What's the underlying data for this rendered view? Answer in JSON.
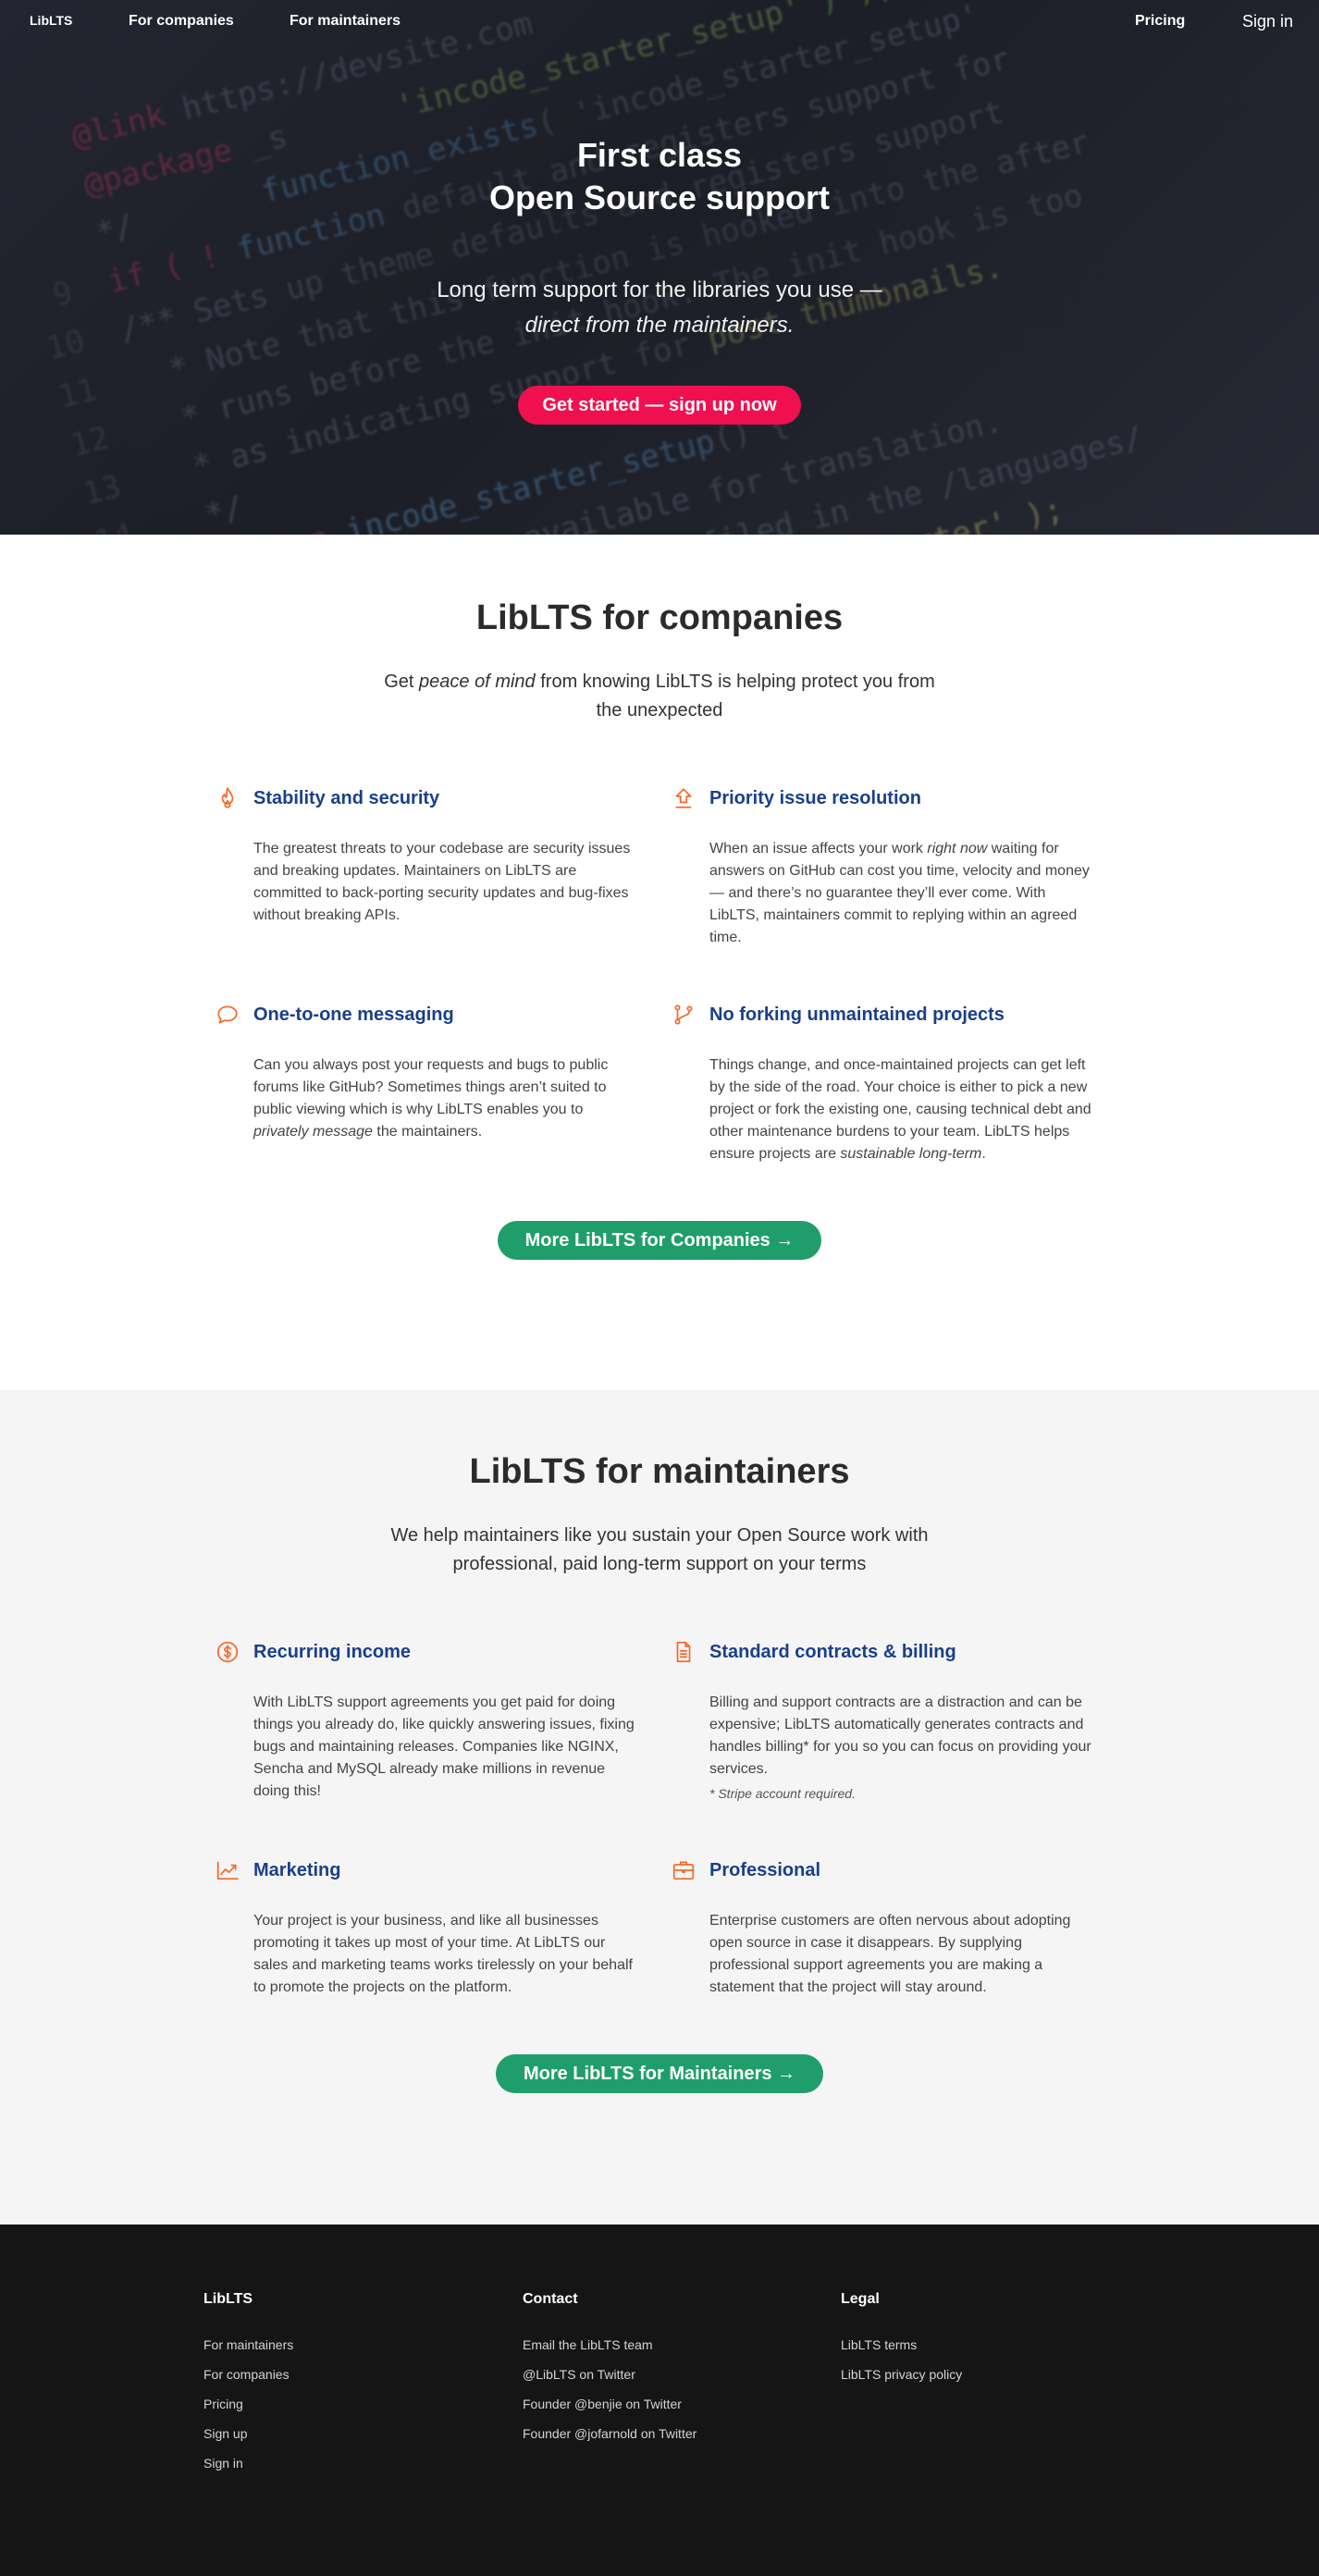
{
  "nav": {
    "brand": "LibLTS",
    "companies": "For companies",
    "maintainers": "For maintainers",
    "pricing": "Pricing",
    "signin": "Sign in"
  },
  "hero": {
    "title_line1": "First class",
    "title_line2": "Open Source support",
    "sub_line1": "Long term support for the libraries you use —",
    "sub_line2": "direct from the maintainers.",
    "cta": "Get started — sign up now"
  },
  "companies": {
    "title": "LibLTS for companies",
    "lead_pre": "Get ",
    "lead_em": "peace of mind",
    "lead_post": " from knowing LibLTS is helping protect you from the unexpected",
    "features": [
      {
        "icon": "flame-icon",
        "title": "Stability and security",
        "text": "The greatest threats to your codebase are security issues and breaking updates. Maintainers on LibLTS are committed to back-porting security updates and bug-fixes without breaking APIs."
      },
      {
        "icon": "upload-icon",
        "title": "Priority issue resolution",
        "text_pre": "When an issue affects your work ",
        "text_em": "right now",
        "text_post": " waiting for answers on GitHub can cost you time, velocity and money — and there’s no guarantee they’ll ever come. With LibLTS, maintainers commit to replying within an agreed time."
      },
      {
        "icon": "chat-bubble-icon",
        "title": "One-to-one messaging",
        "text_pre": "Can you always post your requests and bugs to public forums like GitHub? Sometimes things aren’t suited to public viewing which is why LibLTS enables you to ",
        "text_em": "privately message",
        "text_post": " the maintainers."
      },
      {
        "icon": "git-branch-icon",
        "title": "No forking unmaintained projects",
        "text_pre": "Things change, and once-maintained projects can get left by the side of the road. Your choice is either to pick a new project or fork the existing one, causing technical debt and other maintenance burdens to your team. LibLTS helps ensure projects are ",
        "text_em": "sustainable long-term",
        "text_post": "."
      }
    ],
    "more": "More LibLTS for Companies →"
  },
  "maintainers": {
    "title": "LibLTS for maintainers",
    "lead": "We help maintainers like you sustain your Open Source work with professional, paid long-term support on your terms",
    "features": [
      {
        "icon": "dollar-icon",
        "title": "Recurring income",
        "text": "With LibLTS support agreements you get paid for doing things you already do, like quickly answering issues, fixing bugs and maintaining releases. Companies like NGINX, Sencha and MySQL already make millions in revenue doing this!"
      },
      {
        "icon": "document-icon",
        "title": "Standard contracts & billing",
        "text": "Billing and support contracts are a distraction and can be expensive; LibLTS automatically generates contracts and handles billing* for you so you can focus on providing your services.",
        "note": "* Stripe account required."
      },
      {
        "icon": "trending-up-icon",
        "title": "Marketing",
        "text": "Your project is your business, and like all businesses promoting it takes up most of your time. At LibLTS our sales and marketing teams works tirelessly on your behalf to promote the projects on the platform."
      },
      {
        "icon": "briefcase-icon",
        "title": "Professional",
        "text": "Enterprise customers are often nervous about adopting open source in case it disappears. By supplying professional support agreements you are making a statement that the project will stay around."
      }
    ],
    "more": "More LibLTS for Maintainers →"
  },
  "footer": {
    "col1": {
      "title": "LibLTS",
      "links": [
        "For maintainers",
        "For companies",
        "Pricing",
        "Sign up",
        "Sign in"
      ]
    },
    "col2": {
      "title": "Contact",
      "links": [
        "Email the LibLTS team",
        "@LibLTS on Twitter",
        "Founder @benjie on Twitter",
        "Founder @jofarnold on Twitter"
      ]
    },
    "col3": {
      "title": "Legal",
      "links": [
        "LibLTS terms",
        "LibLTS privacy policy"
      ]
    }
  },
  "colors": {
    "accent_pink": "#f0104f",
    "accent_green": "#1f9e6c",
    "feature_title_blue": "#1a3f8a",
    "icon_orange": "#f26b2a",
    "footer_bg": "#151515"
  }
}
